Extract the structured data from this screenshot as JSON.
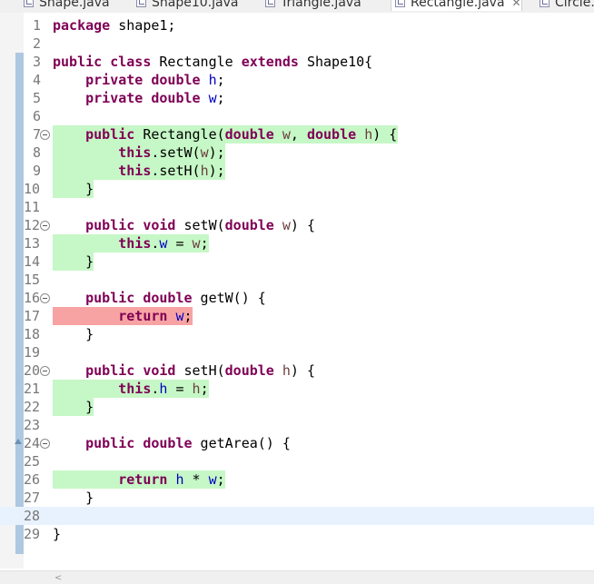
{
  "tabs": [
    {
      "label": "Shape.java",
      "active": false
    },
    {
      "label": "Shape10.java",
      "active": false
    },
    {
      "label": "Triangle.java",
      "active": false
    },
    {
      "label": "Rectangle.java",
      "active": true
    },
    {
      "label": "Circle.j",
      "active": false
    }
  ],
  "close_glyph": "✕",
  "lines": [
    {
      "n": "1",
      "tokens": [
        {
          "t": "package",
          "c": "kw"
        },
        {
          "t": " shape1;"
        }
      ]
    },
    {
      "n": "2",
      "tokens": []
    },
    {
      "n": "3",
      "tokens": [
        {
          "t": "public",
          "c": "kw"
        },
        {
          "t": " "
        },
        {
          "t": "class",
          "c": "kw"
        },
        {
          "t": " Rectangle "
        },
        {
          "t": "extends",
          "c": "kw"
        },
        {
          "t": " Shape10{"
        }
      ]
    },
    {
      "n": "4",
      "tokens": [
        {
          "t": "    "
        },
        {
          "t": "private",
          "c": "kw"
        },
        {
          "t": " "
        },
        {
          "t": "double",
          "c": "kw"
        },
        {
          "t": " "
        },
        {
          "t": "h",
          "c": "field"
        },
        {
          "t": ";"
        }
      ]
    },
    {
      "n": "5",
      "tokens": [
        {
          "t": "    "
        },
        {
          "t": "private",
          "c": "kw"
        },
        {
          "t": " "
        },
        {
          "t": "double",
          "c": "kw"
        },
        {
          "t": " "
        },
        {
          "t": "w",
          "c": "field"
        },
        {
          "t": ";"
        }
      ]
    },
    {
      "n": "6",
      "tokens": []
    },
    {
      "n": "7",
      "fold": true,
      "highlight": "green",
      "tokens": [
        {
          "t": "    "
        },
        {
          "t": "public",
          "c": "kw"
        },
        {
          "t": " Rectangle("
        },
        {
          "t": "double",
          "c": "kw"
        },
        {
          "t": " "
        },
        {
          "t": "w",
          "c": "param"
        },
        {
          "t": ", "
        },
        {
          "t": "double",
          "c": "kw"
        },
        {
          "t": " "
        },
        {
          "t": "h",
          "c": "param"
        },
        {
          "t": ") {"
        }
      ]
    },
    {
      "n": "8",
      "highlight": "green",
      "tokens": [
        {
          "t": "        "
        },
        {
          "t": "this",
          "c": "kw"
        },
        {
          "t": ".setW("
        },
        {
          "t": "w",
          "c": "param"
        },
        {
          "t": ");"
        }
      ]
    },
    {
      "n": "9",
      "highlight": "green",
      "tokens": [
        {
          "t": "        "
        },
        {
          "t": "this",
          "c": "kw"
        },
        {
          "t": ".setH("
        },
        {
          "t": "h",
          "c": "param"
        },
        {
          "t": ");"
        }
      ]
    },
    {
      "n": "10",
      "highlight": "green",
      "tokens": [
        {
          "t": "    }"
        }
      ]
    },
    {
      "n": "11",
      "tokens": []
    },
    {
      "n": "12",
      "fold": true,
      "tokens": [
        {
          "t": "    "
        },
        {
          "t": "public",
          "c": "kw"
        },
        {
          "t": " "
        },
        {
          "t": "void",
          "c": "kw"
        },
        {
          "t": " setW("
        },
        {
          "t": "double",
          "c": "kw"
        },
        {
          "t": " "
        },
        {
          "t": "w",
          "c": "param"
        },
        {
          "t": ") {"
        }
      ]
    },
    {
      "n": "13",
      "highlight": "green",
      "tokens": [
        {
          "t": "        "
        },
        {
          "t": "this",
          "c": "kw"
        },
        {
          "t": "."
        },
        {
          "t": "w",
          "c": "field"
        },
        {
          "t": " = "
        },
        {
          "t": "w",
          "c": "param"
        },
        {
          "t": ";"
        }
      ]
    },
    {
      "n": "14",
      "highlight": "green",
      "tokens": [
        {
          "t": "    }"
        }
      ]
    },
    {
      "n": "15",
      "tokens": []
    },
    {
      "n": "16",
      "fold": true,
      "tokens": [
        {
          "t": "    "
        },
        {
          "t": "public",
          "c": "kw"
        },
        {
          "t": " "
        },
        {
          "t": "double",
          "c": "kw"
        },
        {
          "t": " getW() {"
        }
      ]
    },
    {
      "n": "17",
      "highlight": "red",
      "tokens": [
        {
          "t": "        "
        },
        {
          "t": "return",
          "c": "kw"
        },
        {
          "t": " "
        },
        {
          "t": "w",
          "c": "field"
        },
        {
          "t": ";"
        }
      ]
    },
    {
      "n": "18",
      "tokens": [
        {
          "t": "    }"
        }
      ]
    },
    {
      "n": "19",
      "tokens": []
    },
    {
      "n": "20",
      "fold": true,
      "tokens": [
        {
          "t": "    "
        },
        {
          "t": "public",
          "c": "kw"
        },
        {
          "t": " "
        },
        {
          "t": "void",
          "c": "kw"
        },
        {
          "t": " setH("
        },
        {
          "t": "double",
          "c": "kw"
        },
        {
          "t": " "
        },
        {
          "t": "h",
          "c": "param"
        },
        {
          "t": ") {"
        }
      ]
    },
    {
      "n": "21",
      "highlight": "green",
      "tokens": [
        {
          "t": "        "
        },
        {
          "t": "this",
          "c": "kw"
        },
        {
          "t": "."
        },
        {
          "t": "h",
          "c": "field"
        },
        {
          "t": " = "
        },
        {
          "t": "h",
          "c": "param"
        },
        {
          "t": ";"
        }
      ]
    },
    {
      "n": "22",
      "highlight": "green",
      "tokens": [
        {
          "t": "    }"
        }
      ]
    },
    {
      "n": "23",
      "tokens": []
    },
    {
      "n": "24",
      "fold": true,
      "marker": "override",
      "tokens": [
        {
          "t": "    "
        },
        {
          "t": "public",
          "c": "kw"
        },
        {
          "t": " "
        },
        {
          "t": "double",
          "c": "kw"
        },
        {
          "t": " getArea() {"
        }
      ]
    },
    {
      "n": "25",
      "tokens": []
    },
    {
      "n": "26",
      "highlight": "green",
      "tokens": [
        {
          "t": "        "
        },
        {
          "t": "return",
          "c": "kw"
        },
        {
          "t": " "
        },
        {
          "t": "h",
          "c": "field"
        },
        {
          "t": " * "
        },
        {
          "t": "w",
          "c": "field"
        },
        {
          "t": ";"
        }
      ]
    },
    {
      "n": "27",
      "tokens": [
        {
          "t": "    }"
        }
      ]
    },
    {
      "n": "28",
      "current": true,
      "tokens": []
    },
    {
      "n": "29",
      "tokens": [
        {
          "t": "}"
        }
      ]
    }
  ]
}
